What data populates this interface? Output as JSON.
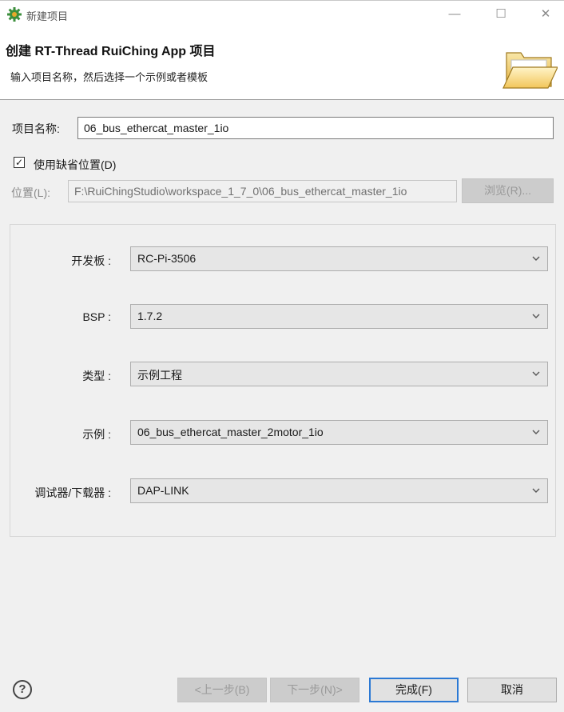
{
  "window": {
    "title": "新建项目",
    "icon": "gear-icon",
    "controls": {
      "minimize": "—",
      "maximize": "☐",
      "close": "✕"
    }
  },
  "header": {
    "title": "创建 RT-Thread RuiChing App 项目",
    "subtitle": "输入项目名称，然后选择一个示例或者模板",
    "icon": "folder-icon"
  },
  "project": {
    "name_label": "项目名称:",
    "name_value": "06_bus_ethercat_master_1io",
    "default_location_label": "使用缺省位置(D)",
    "default_location_checked": true,
    "location_label": "位置(L):",
    "location_value": "F:\\RuiChingStudio\\workspace_1_7_0\\06_bus_ethercat_master_1io",
    "browse_label": "浏览(R)..."
  },
  "fields": [
    {
      "label": "开发板 :",
      "value": "RC-Pi-3506"
    },
    {
      "label": "BSP :",
      "value": "1.7.2"
    },
    {
      "label": "类型 :",
      "value": "示例工程"
    },
    {
      "label": "示例 :",
      "value": "06_bus_ethercat_master_2motor_1io"
    },
    {
      "label": "调试器/下载器 :",
      "value": "DAP-LINK"
    }
  ],
  "footer": {
    "help": "?",
    "back_label": "<上一步(B)",
    "next_label": "下一步(N)>",
    "finish_label": "完成(F)",
    "cancel_label": "取消"
  },
  "colors": {
    "accent": "#2b79d4",
    "background": "#f0f0f0"
  }
}
